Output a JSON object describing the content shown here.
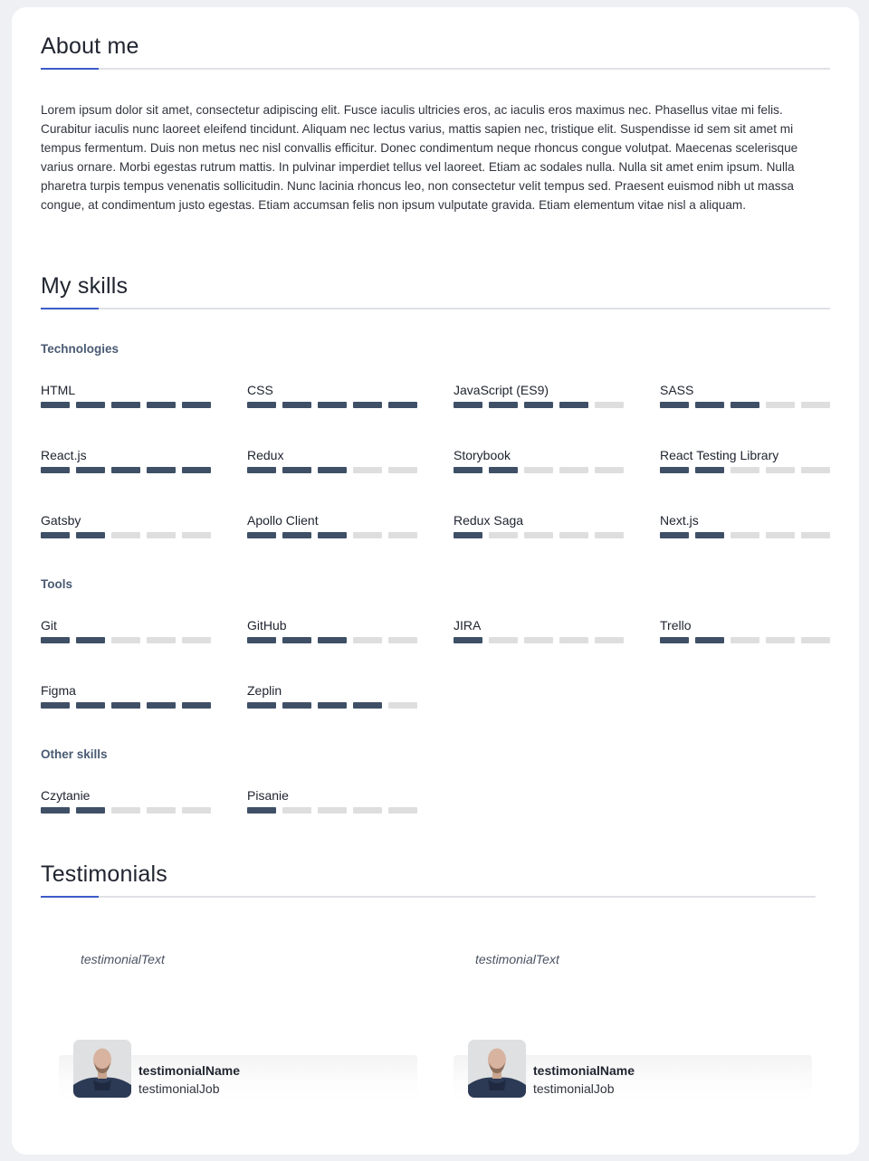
{
  "about": {
    "title": "About me",
    "text": "Lorem ipsum dolor sit amet, consectetur adipiscing elit. Fusce iaculis ultricies eros, ac iaculis eros maximus nec. Phasellus vitae mi felis. Curabitur iaculis nunc laoreet eleifend tincidunt. Aliquam nec lectus varius, mattis sapien nec, tristique elit. Suspendisse id sem sit amet mi tempus fermentum. Duis non metus nec nisl convallis efficitur. Donec condimentum neque rhoncus congue volutpat. Maecenas scelerisque varius ornare. Morbi egestas rutrum mattis. In pulvinar imperdiet tellus vel laoreet. Etiam ac sodales nulla. Nulla sit amet enim ipsum. Nulla pharetra turpis tempus venenatis sollicitudin. Nunc lacinia rhoncus leo, non consectetur velit tempus sed. Praesent euismod nibh ut massa congue, at condimentum justo egestas. Etiam accumsan felis non ipsum vulputate gravida. Etiam elementum vitae nisl a aliquam."
  },
  "skills": {
    "title": "My skills",
    "max_level": 5,
    "groups": [
      {
        "label": "Technologies",
        "items": [
          {
            "name": "HTML",
            "level": 5
          },
          {
            "name": "CSS",
            "level": 5
          },
          {
            "name": "JavaScript (ES9)",
            "level": 4
          },
          {
            "name": "SASS",
            "level": 3
          },
          {
            "name": "React.js",
            "level": 5
          },
          {
            "name": "Redux",
            "level": 3
          },
          {
            "name": "Storybook",
            "level": 2
          },
          {
            "name": "React Testing Library",
            "level": 2
          },
          {
            "name": "Gatsby",
            "level": 2
          },
          {
            "name": "Apollo Client",
            "level": 3
          },
          {
            "name": "Redux Saga",
            "level": 1
          },
          {
            "name": "Next.js",
            "level": 2
          }
        ]
      },
      {
        "label": "Tools",
        "items": [
          {
            "name": "Git",
            "level": 2
          },
          {
            "name": "GitHub",
            "level": 3
          },
          {
            "name": "JIRA",
            "level": 1
          },
          {
            "name": "Trello",
            "level": 2
          },
          {
            "name": "Figma",
            "level": 5
          },
          {
            "name": "Zeplin",
            "level": 4
          }
        ]
      },
      {
        "label": "Other skills",
        "items": [
          {
            "name": "Czytanie",
            "level": 2
          },
          {
            "name": "Pisanie",
            "level": 1
          }
        ]
      }
    ]
  },
  "testimonials": {
    "title": "Testimonials",
    "items": [
      {
        "text": "testimonialText",
        "name": "testimonialName",
        "job": "testimonialJob"
      },
      {
        "text": "testimonialText",
        "name": "testimonialName",
        "job": "testimonialJob"
      }
    ]
  },
  "colors": {
    "accent": "#3d5bc9",
    "bar_filled": "#3f5066",
    "bar_empty": "#dedede",
    "group_label": "#4a5a73"
  }
}
